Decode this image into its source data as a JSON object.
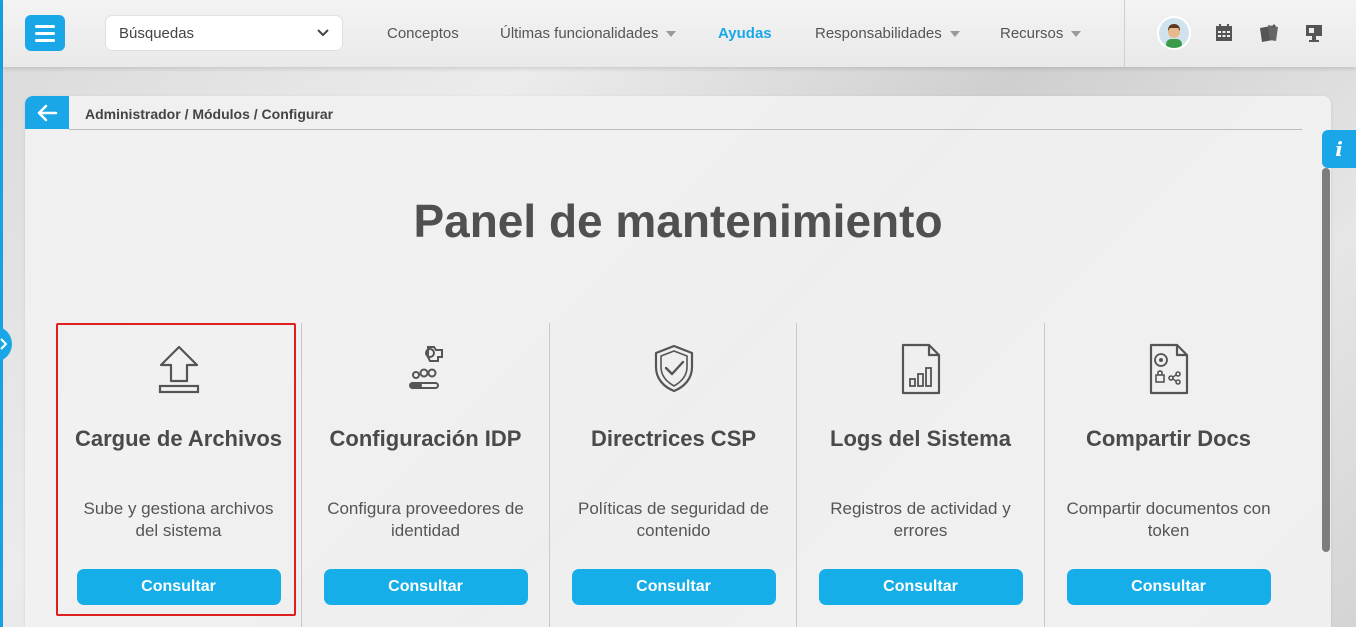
{
  "topbar": {
    "search_select_value": "Búsquedas",
    "nav": [
      {
        "label": "Conceptos"
      },
      {
        "label": "Últimas funcionalidades"
      },
      {
        "label": "Ayudas"
      },
      {
        "label": "Responsabilidades"
      },
      {
        "label": "Recursos"
      }
    ],
    "active_nav": "Ayudas",
    "icons": [
      "menu-icon",
      "avatar",
      "calendar-icon",
      "notes-icon",
      "monitor-icon"
    ]
  },
  "breadcrumb": "Administrador / Módulos / Configurar",
  "page_title": "Panel de mantenimiento",
  "cards": [
    {
      "icon": "upload-icon",
      "title": "Cargue de Archivos",
      "desc": "Sube y gestiona archivos del sistema",
      "button": "Consultar"
    },
    {
      "icon": "idp-config-icon",
      "title": "Configuración IDP",
      "desc": "Configura proveedores de identidad",
      "button": "Consultar"
    },
    {
      "icon": "shield-check-icon",
      "title": "Directrices CSP",
      "desc": "Políticas de seguridad de contenido",
      "button": "Consultar"
    },
    {
      "icon": "chart-document-icon",
      "title": "Logs del Sistema",
      "desc": "Registros de actividad y errores",
      "button": "Consultar"
    },
    {
      "icon": "share-document-icon",
      "title": "Compartir Docs",
      "desc": "Compartir documentos con token",
      "button": "Consultar"
    }
  ],
  "info_tab_label": "i",
  "colors": {
    "accent": "#1aa7e8",
    "highlight": "#e02020"
  }
}
